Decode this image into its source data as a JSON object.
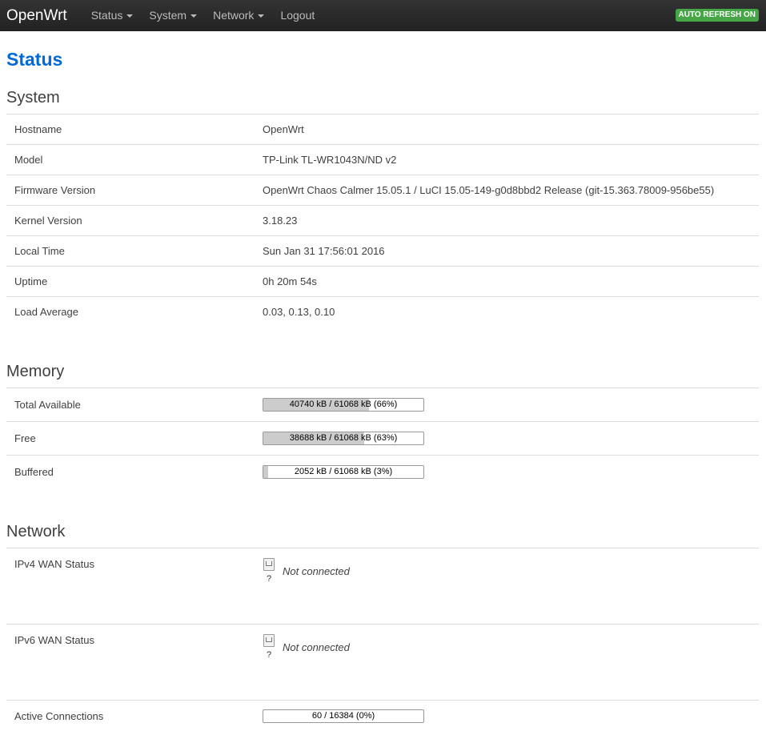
{
  "navbar": {
    "brand": "OpenWrt",
    "menus": [
      {
        "label": "Status",
        "dropdown": true
      },
      {
        "label": "System",
        "dropdown": true
      },
      {
        "label": "Network",
        "dropdown": true
      },
      {
        "label": "Logout",
        "dropdown": false
      }
    ],
    "auto_refresh": "AUTO REFRESH ON"
  },
  "page": {
    "title": "Status"
  },
  "system": {
    "heading": "System",
    "rows": [
      {
        "label": "Hostname",
        "value": "OpenWrt"
      },
      {
        "label": "Model",
        "value": "TP-Link TL-WR1043N/ND v2"
      },
      {
        "label": "Firmware Version",
        "value": "OpenWrt Chaos Calmer 15.05.1 / LuCI 15.05-149-g0d8bbd2 Release (git-15.363.78009-956be55)"
      },
      {
        "label": "Kernel Version",
        "value": "3.18.23"
      },
      {
        "label": "Local Time",
        "value": "Sun Jan 31 17:56:01 2016"
      },
      {
        "label": "Uptime",
        "value": "0h 20m 54s"
      },
      {
        "label": "Load Average",
        "value": "0.03, 0.13, 0.10"
      }
    ]
  },
  "memory": {
    "heading": "Memory",
    "rows": [
      {
        "label": "Total Available",
        "text": "40740 kB / 61068 kB (66%)",
        "percent": 66
      },
      {
        "label": "Free",
        "text": "38688 kB / 61068 kB (63%)",
        "percent": 63
      },
      {
        "label": "Buffered",
        "text": "2052 kB / 61068 kB (3%)",
        "percent": 3
      }
    ]
  },
  "network": {
    "heading": "Network",
    "rows": [
      {
        "label": "IPv4 WAN Status",
        "icon_caption": "?",
        "status": "Not connected"
      },
      {
        "label": "IPv6 WAN Status",
        "icon_caption": "?",
        "status": "Not connected"
      }
    ],
    "connections": {
      "label": "Active Connections",
      "text": "60 / 16384 (0%)",
      "percent": 0
    }
  },
  "colors": {
    "navbar_bg": "#222222",
    "title_blue": "#0069d6",
    "badge_green": "#46a546",
    "bar_fill": "#cccccc"
  },
  "icons": {
    "menu_caret": "caret-down-icon",
    "wan_interface": "ethernet-port-icon"
  }
}
